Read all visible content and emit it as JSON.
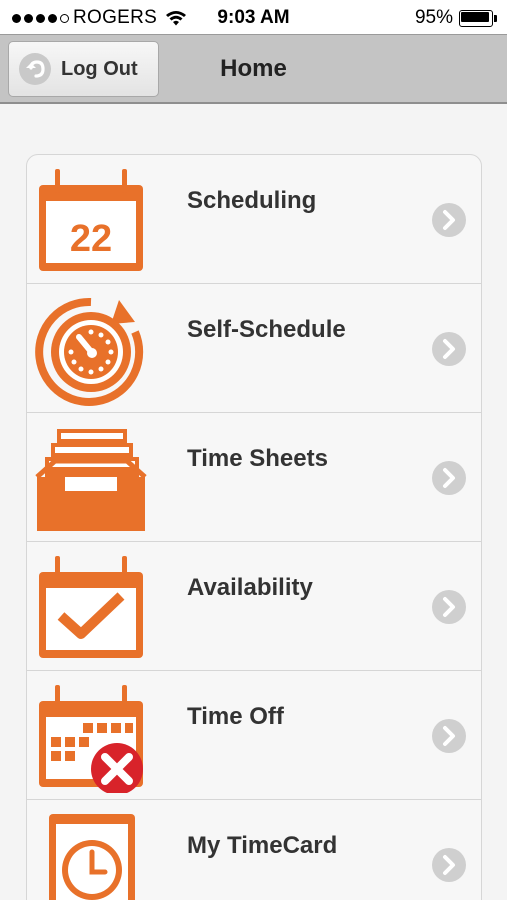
{
  "status_bar": {
    "carrier": "ROGERS",
    "time": "9:03 AM",
    "battery_percent_label": "95%",
    "battery_level": 0.95,
    "signal_bars_filled": 4,
    "signal_bars_total": 5
  },
  "nav": {
    "logout_label": "Log Out",
    "title": "Home"
  },
  "colors": {
    "accent": "#e8712a",
    "nav_background": "#c4c4c4",
    "chevron": "#cfcfcf",
    "cancel_badge": "#d8232a"
  },
  "menu": {
    "items": [
      {
        "label": "Scheduling",
        "icon": "calendar-22-icon",
        "calendar_day": "22"
      },
      {
        "label": "Self-Schedule",
        "icon": "stopwatch-refresh-icon"
      },
      {
        "label": "Time Sheets",
        "icon": "file-tray-icon"
      },
      {
        "label": "Availability",
        "icon": "calendar-check-icon"
      },
      {
        "label": "Time Off",
        "icon": "calendar-cancel-icon"
      },
      {
        "label": "My TimeCard",
        "icon": "timecard-clock-icon"
      }
    ]
  }
}
